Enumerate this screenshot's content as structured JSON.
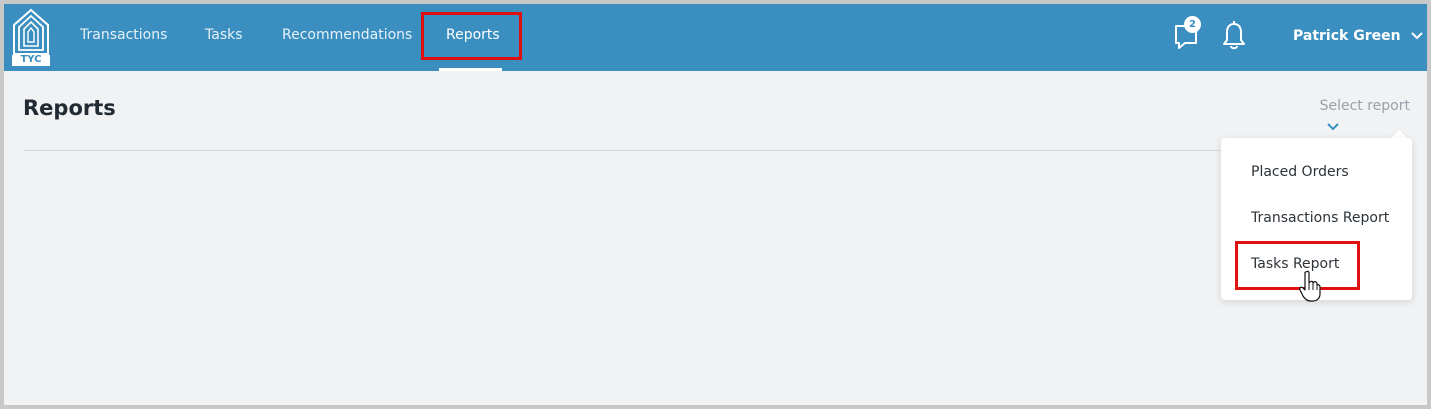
{
  "logo": {
    "text": "TYC"
  },
  "nav": {
    "items": [
      {
        "label": "Transactions"
      },
      {
        "label": "Tasks"
      },
      {
        "label": "Recommendations"
      },
      {
        "label": "Reports"
      }
    ]
  },
  "header": {
    "messages_badge": "2",
    "user_name": "Patrick Green"
  },
  "page": {
    "title": "Reports",
    "select_placeholder": "Select report"
  },
  "dropdown": {
    "items": [
      {
        "label": "Placed Orders"
      },
      {
        "label": "Transactions Report"
      },
      {
        "label": "Tasks Report"
      }
    ]
  },
  "colors": {
    "topbar": "#3b8fc0",
    "highlight": "#e01010",
    "background": "#f0f2f4"
  },
  "icons": [
    "logo-house-icon",
    "chat-icon",
    "bell-icon",
    "chevron-down-icon",
    "hand-cursor-icon"
  ]
}
